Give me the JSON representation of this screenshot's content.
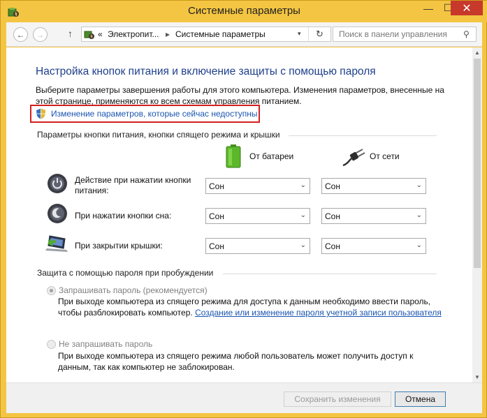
{
  "window": {
    "title": "Системные параметры",
    "accent_color": "#f4c542",
    "minimize_glyph": "—",
    "maximize_glyph": "☐",
    "close_glyph": "✕"
  },
  "navigation": {
    "back_glyph": "←",
    "forward_glyph": "→",
    "up_glyph": "↑",
    "address_prefix": "«",
    "breadcrumb_1": "Электропит...",
    "breadcrumb_separator": "▸",
    "breadcrumb_2": "Системные параметры",
    "dropdown_glyph": "▾",
    "refresh_glyph": "↻",
    "search_placeholder": "Поиск в панели управления",
    "search_glyph": "⚲"
  },
  "main": {
    "heading": "Настройка кнопок питания и включение защиты с помощью пароля",
    "description": "Выберите параметры завершения работы для этого компьютера. Изменения параметров, внесенные на этой странице, применяются ко всем схемам управления питанием.",
    "change_settings_link": "Изменение параметров, которые сейчас недоступны",
    "highlight_color": "#d42020"
  },
  "power_buttons": {
    "section_title": "Параметры кнопки питания, кнопки спящего режима и крышки",
    "col_battery": "От батареи",
    "col_ac": "От сети",
    "rows": [
      {
        "label": "Действие при нажатии кнопки питания:",
        "icon": "power-button-icon",
        "battery": "Сон",
        "ac": "Сон"
      },
      {
        "label": "При нажатии кнопки сна:",
        "icon": "sleep-button-icon",
        "battery": "Сон",
        "ac": "Сон"
      },
      {
        "label": "При закрытии крышки:",
        "icon": "laptop-lid-icon",
        "battery": "Сон",
        "ac": "Сон"
      }
    ],
    "select_arrow": "⌄"
  },
  "password": {
    "section_title": "Защита с помощью пароля при пробуждении",
    "option_require": {
      "label": "Запрашивать пароль (рекомендуется)",
      "checked": true,
      "description": "При выходе компьютера из спящего режима для доступа к данным необходимо ввести пароль, чтобы разблокировать компьютер.",
      "link": "Создание или изменение пароля учетной записи пользователя"
    },
    "option_no_require": {
      "label": "Не запрашивать пароль",
      "checked": false,
      "description": "При выходе компьютера из спящего режима любой пользователь может получить доступ к данным, так как компьютер не заблокирован."
    }
  },
  "footer": {
    "save_label": "Сохранить изменения",
    "cancel_label": "Отмена"
  }
}
